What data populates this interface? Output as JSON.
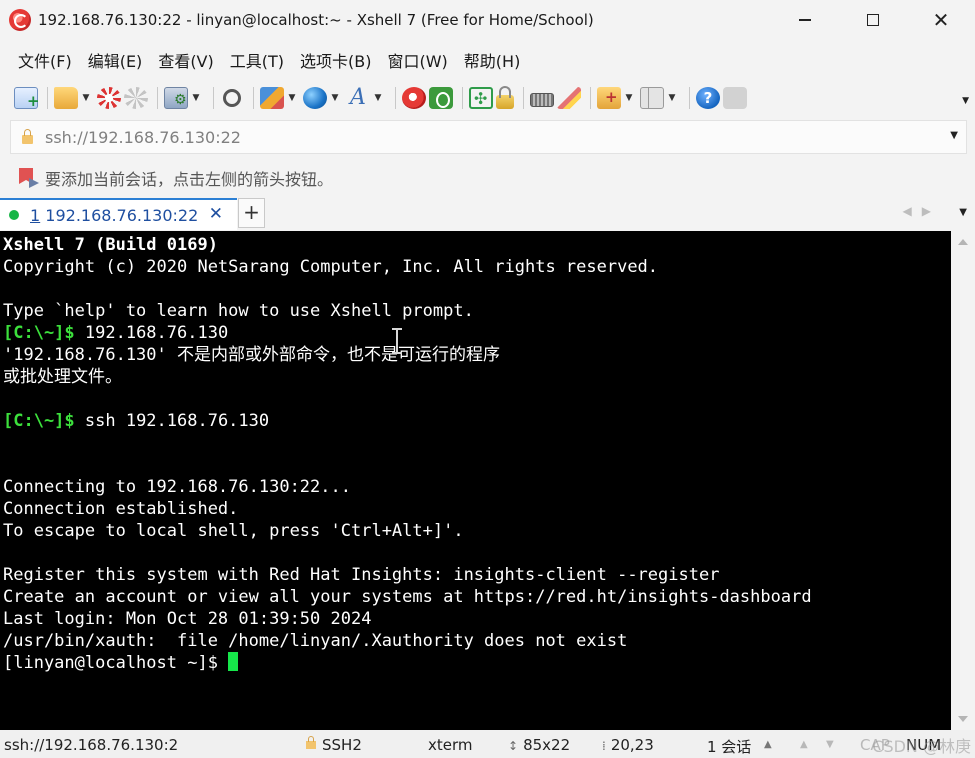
{
  "window": {
    "title": "192.168.76.130:22 - linyan@localhost:~ - Xshell 7 (Free for Home/School)"
  },
  "menu": {
    "items": [
      "文件(F)",
      "编辑(E)",
      "查看(V)",
      "工具(T)",
      "选项卡(B)",
      "窗口(W)",
      "帮助(H)"
    ]
  },
  "toolbar": {
    "icons": [
      "new-session-icon",
      "open-folder-icon",
      "reconnect-icon",
      "disconnect-icon",
      "properties-icon",
      "find-icon",
      "transfer-icon",
      "globe-icon",
      "font-icon",
      "xshell-icon",
      "xftp-icon",
      "fullscreen-icon",
      "lock-icon",
      "keyboard-icon",
      "highlight-icon",
      "compose-icon",
      "layout-icon",
      "help-icon",
      "chat-icon"
    ]
  },
  "address": {
    "value": "ssh://192.168.76.130:22"
  },
  "hint": {
    "text": "要添加当前会话，点击左侧的箭头按钮。"
  },
  "tabs": [
    {
      "number": "1",
      "label": " 192.168.76.130:22",
      "status_color": "#17b546"
    }
  ],
  "terminal": {
    "lines": [
      {
        "parts": [
          {
            "t": "Xshell 7 (Build 0169)",
            "style": "bold"
          }
        ]
      },
      {
        "parts": [
          {
            "t": "Copyright (c) 2020 NetSarang Computer, Inc. All rights reserved."
          }
        ]
      },
      {
        "parts": [
          {
            "t": ""
          }
        ]
      },
      {
        "parts": [
          {
            "t": "Type `help' to learn how to use Xshell prompt."
          }
        ]
      },
      {
        "parts": [
          {
            "t": "[C:\\~]$",
            "style": "prompt"
          },
          {
            "t": " 192.168.76.130"
          }
        ]
      },
      {
        "parts": [
          {
            "t": "'192.168.76.130' 不是内部或外部命令，也不是可运行的程序"
          }
        ]
      },
      {
        "parts": [
          {
            "t": "或批处理文件。"
          }
        ]
      },
      {
        "parts": [
          {
            "t": ""
          }
        ]
      },
      {
        "parts": [
          {
            "t": "[C:\\~]$",
            "style": "prompt"
          },
          {
            "t": " ssh 192.168.76.130"
          }
        ]
      },
      {
        "parts": [
          {
            "t": ""
          }
        ]
      },
      {
        "parts": [
          {
            "t": ""
          }
        ]
      },
      {
        "parts": [
          {
            "t": "Connecting to 192.168.76.130:22..."
          }
        ]
      },
      {
        "parts": [
          {
            "t": "Connection established."
          }
        ]
      },
      {
        "parts": [
          {
            "t": "To escape to local shell, press 'Ctrl+Alt+]'."
          }
        ]
      },
      {
        "parts": [
          {
            "t": ""
          }
        ]
      },
      {
        "parts": [
          {
            "t": "Register this system with Red Hat Insights: insights-client --register"
          }
        ]
      },
      {
        "parts": [
          {
            "t": "Create an account or view all your systems at https://red.ht/insights-dashboard"
          }
        ]
      },
      {
        "parts": [
          {
            "t": "Last login: Mon Oct 28 01:39:50 2024"
          }
        ]
      },
      {
        "parts": [
          {
            "t": "/usr/bin/xauth:  file /home/linyan/.Xauthority does not exist"
          }
        ]
      },
      {
        "parts": [
          {
            "t": "[linyan@localhost ~]$ "
          },
          {
            "cursor": true
          }
        ]
      }
    ],
    "cursor_color": "#16e64a",
    "prompt_color": "#3ce03c"
  },
  "status": {
    "address": "ssh://192.168.76.130:2",
    "protocol": "SSH2",
    "terminal_type": "xterm",
    "size": "85x22",
    "position": "20,23",
    "sessions": "1 会话",
    "caps": "CAP",
    "num": "NUM",
    "watermark": "CSDN @林庚"
  }
}
